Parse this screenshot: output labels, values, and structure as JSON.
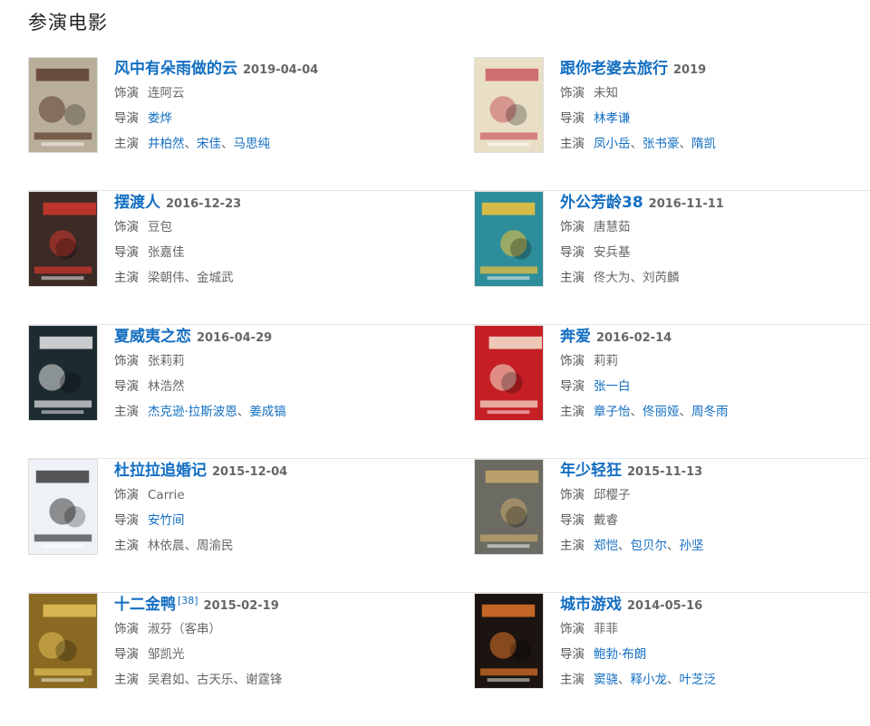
{
  "section": {
    "title": "参演电影"
  },
  "labels": {
    "role": "饰演",
    "director": "导演",
    "stars": "主演"
  },
  "movies": [
    {
      "title": "风中有朵雨做的云",
      "sup": "",
      "date": "2019-04-04",
      "role": "连阿云",
      "role_link": false,
      "director": [
        "娄烨"
      ],
      "director_link": true,
      "stars": [
        "井柏然",
        "宋佳",
        "马思纯"
      ],
      "stars_link": true,
      "poster": {
        "bg": "#b9ae9a",
        "accent": "#5a3b2b"
      }
    },
    {
      "title": "跟你老婆去旅行",
      "sup": "",
      "date": "2019",
      "role": "未知",
      "role_link": false,
      "director": [
        "林孝谦"
      ],
      "director_link": true,
      "stars": [
        "凤小岳",
        "张书豪",
        "隋凯"
      ],
      "stars_link": true,
      "poster": {
        "bg": "#e9dfc6",
        "accent": "#c95a63"
      }
    },
    {
      "title": "摆渡人",
      "sup": "",
      "date": "2016-12-23",
      "role": "豆包",
      "role_link": false,
      "director": [
        "张嘉佳"
      ],
      "director_link": false,
      "stars": [
        "梁朝伟",
        "金城武"
      ],
      "stars_link": false,
      "poster": {
        "bg": "#3b2a26",
        "accent": "#d2372c"
      }
    },
    {
      "title": "外公芳龄38",
      "sup": "",
      "date": "2016-11-11",
      "role": "唐慧茹",
      "role_link": false,
      "director": [
        "安兵基"
      ],
      "director_link": false,
      "stars": [
        "佟大为",
        "刘芮麟"
      ],
      "stars_link": false,
      "poster": {
        "bg": "#2e8d9a",
        "accent": "#f2c23a"
      }
    },
    {
      "title": "夏威夷之恋",
      "sup": "",
      "date": "2016-04-29",
      "role": "张莉莉",
      "role_link": false,
      "director": [
        "林浩然"
      ],
      "director_link": false,
      "stars": [
        "杰克逊·拉斯波恩",
        "姜成镐"
      ],
      "stars_link": true,
      "poster": {
        "bg": "#1c2b30",
        "accent": "#e8e8e8"
      }
    },
    {
      "title": "奔爱",
      "sup": "",
      "date": "2016-02-14",
      "role": "莉莉",
      "role_link": false,
      "director": [
        "张一白"
      ],
      "director_link": true,
      "stars": [
        "章子怡",
        "佟丽娅",
        "周冬雨"
      ],
      "stars_link": true,
      "poster": {
        "bg": "#c51f25",
        "accent": "#f3e6d3"
      }
    },
    {
      "title": "杜拉拉追婚记",
      "sup": "",
      "date": "2015-12-04",
      "role": "Carrie",
      "role_link": false,
      "director": [
        "安竹间"
      ],
      "director_link": true,
      "stars": [
        "林依晨",
        "周渝民"
      ],
      "stars_link": false,
      "poster": {
        "bg": "#eef2f6",
        "accent": "#3b3b3b"
      }
    },
    {
      "title": "年少轻狂",
      "sup": "",
      "date": "2015-11-13",
      "role": "邱樱子",
      "role_link": false,
      "director": [
        "戴睿"
      ],
      "director_link": false,
      "stars": [
        "郑恺",
        "包贝尔",
        "孙坚"
      ],
      "stars_link": true,
      "poster": {
        "bg": "#6b6a63",
        "accent": "#c7a86b"
      }
    },
    {
      "title": "十二金鸭",
      "sup": "[38]",
      "date": "2015-02-19",
      "role": "淑芬（客串）",
      "role_link": false,
      "director": [
        "邹凯光"
      ],
      "director_link": false,
      "stars": [
        "吴君如",
        "古天乐",
        "谢霆锋"
      ],
      "stars_link": false,
      "poster": {
        "bg": "#8a6a22",
        "accent": "#e6c25a"
      }
    },
    {
      "title": "城市游戏",
      "sup": "",
      "date": "2014-05-16",
      "role": "菲菲",
      "role_link": false,
      "director": [
        "鲍勃·布朗"
      ],
      "director_link": true,
      "stars": [
        "窦骁",
        "释小龙",
        "叶芝泛"
      ],
      "stars_link": true,
      "poster": {
        "bg": "#1b1410",
        "accent": "#e0742a"
      }
    }
  ]
}
